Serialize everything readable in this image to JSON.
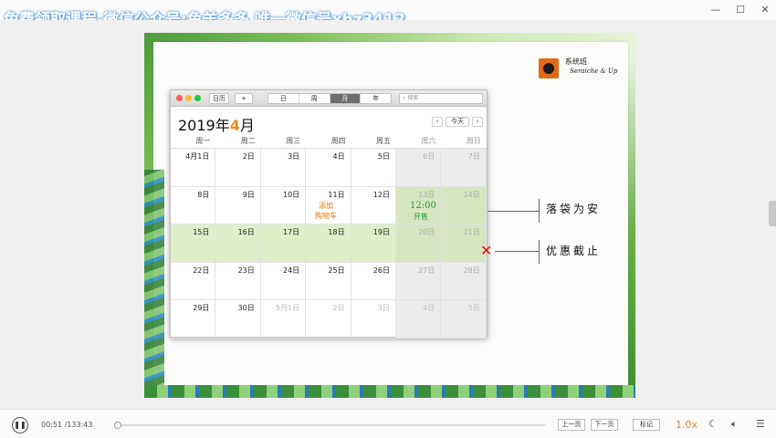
{
  "watermark": "免费领取课程-微信公众号:鱼羊多多 唯一微信号xhz3412",
  "window": {
    "minimize": "—",
    "maximize": "☐",
    "close": "✕"
  },
  "slide": {
    "logo_title": "系统班",
    "logo_subtitle": "Seraiche & Up",
    "calendar": {
      "toolbar": {
        "calendars_button": "日历",
        "add_button": "+",
        "views": [
          "日",
          "周",
          "月",
          "年"
        ],
        "active_view": "月",
        "search_placeholder": "搜索"
      },
      "month_year": "2019年",
      "month_num": "4",
      "month_suffix": "月",
      "nav": {
        "prev": "‹",
        "today": "今天",
        "next": "›"
      },
      "weekdays": [
        "周一",
        "周二",
        "周三",
        "周四",
        "周五",
        "周六",
        "周日"
      ],
      "weeks": [
        [
          "4月1日",
          "2日",
          "3日",
          "4日",
          "5日",
          "6日",
          "7日"
        ],
        [
          "8日",
          "9日",
          "10日",
          "11日",
          "12日",
          "13日",
          "14日"
        ],
        [
          "15日",
          "16日",
          "17日",
          "18日",
          "19日",
          "20日",
          "21日"
        ],
        [
          "22日",
          "23日",
          "24日",
          "25日",
          "26日",
          "27日",
          "28日"
        ],
        [
          "29日",
          "30日",
          "5月1日",
          "2日",
          "3日",
          "4日",
          "5日"
        ]
      ],
      "notes": {
        "add_cart": "添加\n购物车",
        "time": "12:00",
        "open_sale": "开售"
      }
    },
    "callouts": {
      "presale": "落袋为安",
      "deadline": "优惠截止"
    },
    "colors": {
      "accent": "#f08a1c",
      "highlight": "#dfefc8",
      "note_orange": "#e07a10",
      "note_green": "#1f9a32",
      "cross": "#d11111"
    }
  },
  "player": {
    "play_icon": "pause-icon",
    "current_time": "00:51",
    "total_time": "/133:43",
    "progress": 0.006,
    "prev_button": "上一页",
    "next_button": "下一页",
    "mark_button": "标记",
    "speed": "1.0x"
  }
}
